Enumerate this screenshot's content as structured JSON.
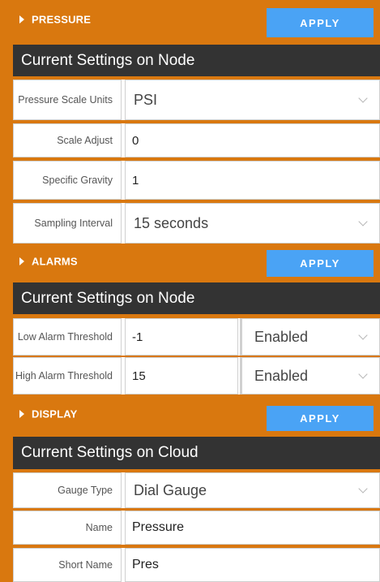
{
  "pressure": {
    "title": "PRESSURE",
    "apply_label": "APPLY",
    "subheader": "Current Settings on Node",
    "rows": [
      {
        "label": "Pressure Scale Units",
        "value": "PSI"
      },
      {
        "label": "Scale Adjust",
        "value": "0"
      },
      {
        "label": "Specific Gravity",
        "value": "1"
      },
      {
        "label": "Sampling Interval",
        "value": "15 seconds"
      }
    ]
  },
  "alarms": {
    "title": "ALARMS",
    "apply_label": "APPLY",
    "subheader": "Current Settings on Node",
    "rows": [
      {
        "label": "Low Alarm Threshold",
        "value": "-1",
        "state": "Enabled"
      },
      {
        "label": "High Alarm Threshold",
        "value": "15",
        "state": "Enabled"
      }
    ]
  },
  "display": {
    "title": "DISPLAY",
    "apply_label": "APPLY",
    "subheader": "Current Settings on Cloud",
    "rows": [
      {
        "label": "Gauge Type",
        "value": "Dial Gauge"
      },
      {
        "label": "Name",
        "value": "Pressure"
      },
      {
        "label": "Short Name",
        "value": "Pres"
      }
    ]
  },
  "colors": {
    "header_orange": "#d9780f",
    "apply_blue": "#4aa3f5",
    "subheader_dark": "#333333"
  },
  "icons": {
    "section_toggle": "caret-right-icon",
    "dropdown": "chevron-down-icon"
  }
}
